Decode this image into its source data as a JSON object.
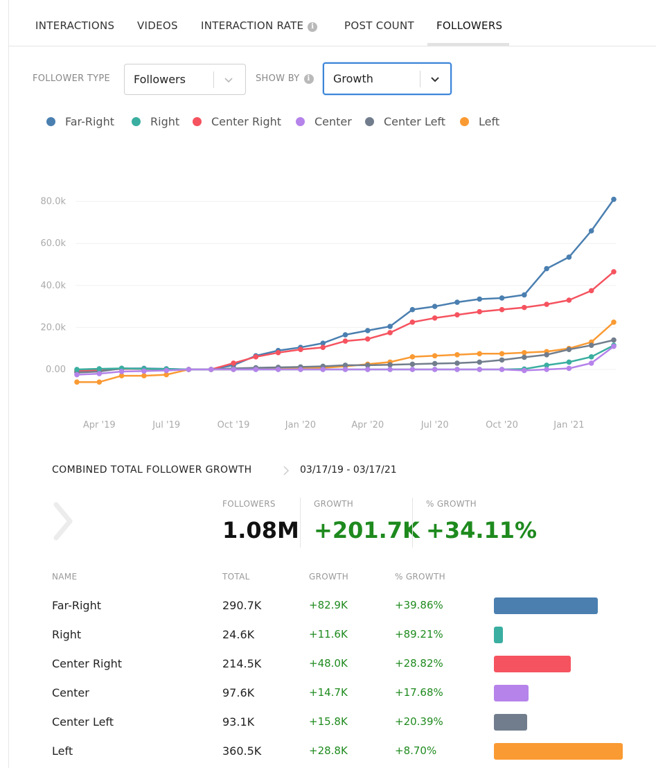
{
  "tabs": [
    {
      "label": "INTERACTIONS"
    },
    {
      "label": "VIDEOS"
    },
    {
      "label": "INTERACTION RATE"
    },
    {
      "label": "POST COUNT"
    },
    {
      "label": "FOLLOWERS",
      "active": true
    }
  ],
  "filters": {
    "follower_type_label": "FOLLOWER TYPE",
    "follower_type_value": "Followers",
    "show_by_label": "SHOW BY",
    "show_by_value": "Growth"
  },
  "chart_data": {
    "type": "line",
    "series": [
      {
        "name": "Far-Right",
        "color": "#4a7fb0",
        "values": [
          -1000,
          -600,
          500,
          500,
          300,
          0,
          0,
          2000,
          6500,
          9000,
          10500,
          12500,
          16500,
          18500,
          20500,
          28500,
          30000,
          32000,
          33500,
          34000,
          35500,
          48000,
          53500,
          66000,
          81000
        ]
      },
      {
        "name": "Right",
        "color": "#3aaea0",
        "values": [
          0,
          300,
          500,
          300,
          200,
          0,
          0,
          0,
          0,
          0,
          0,
          0,
          0,
          0,
          0,
          0,
          0,
          0,
          0,
          0,
          200,
          2000,
          3500,
          6000,
          11500
        ]
      },
      {
        "name": "Center Right",
        "color": "#f5535f",
        "values": [
          -500,
          -400,
          300,
          200,
          0,
          0,
          0,
          3000,
          6000,
          8000,
          9500,
          10500,
          13500,
          14500,
          17500,
          22500,
          24500,
          26000,
          27500,
          28500,
          29500,
          31000,
          33000,
          37500,
          46500
        ]
      },
      {
        "name": "Center",
        "color": "#b583ea",
        "values": [
          -2500,
          -2000,
          -1000,
          -800,
          -500,
          0,
          0,
          0,
          0,
          0,
          0,
          0,
          0,
          0,
          0,
          0,
          0,
          0,
          0,
          0,
          -500,
          0,
          500,
          3000,
          11000
        ]
      },
      {
        "name": "Center Left",
        "color": "#717d8c",
        "values": [
          -1500,
          -1000,
          500,
          300,
          0,
          0,
          0,
          500,
          800,
          1000,
          1200,
          1500,
          2000,
          2000,
          2200,
          2500,
          2800,
          3000,
          3500,
          4500,
          5800,
          7000,
          9500,
          11500,
          14000
        ]
      },
      {
        "name": "Left",
        "color": "#fa9a33",
        "values": [
          -6000,
          -6000,
          -3000,
          -3000,
          -2500,
          0,
          0,
          0,
          500,
          500,
          700,
          800,
          1500,
          2500,
          3500,
          6000,
          6500,
          7000,
          7500,
          7500,
          8000,
          8500,
          10000,
          13000,
          22500
        ]
      }
    ],
    "x_labels": [
      "Apr '19",
      "Jul '19",
      "Oct '19",
      "Jan '20",
      "Apr '20",
      "Jul '20",
      "Oct '20",
      "Jan '21"
    ],
    "y_ticks": [
      "0.00",
      "20.0k",
      "40.0k",
      "60.0k",
      "80.0k"
    ],
    "ylim": [
      -10000,
      90000
    ],
    "grid": true,
    "legend_position": "top-left"
  },
  "summary": {
    "title": "COMBINED TOTAL FOLLOWER GROWTH",
    "range": "03/17/19 - 03/17/21",
    "followers_label": "FOLLOWERS",
    "followers_value": "1.08M",
    "growth_label": "GROWTH",
    "growth_value": "+201.7K",
    "pct_label": "% GROWTH",
    "pct_value": "+34.11%"
  },
  "table": {
    "headers": [
      "NAME",
      "TOTAL",
      "GROWTH",
      "% GROWTH"
    ],
    "rows": [
      {
        "name": "Far-Right",
        "total": "290.7K",
        "growth": "+82.9K",
        "pct": "+39.86%",
        "color": "#4a7fb0",
        "share": 0.806
      },
      {
        "name": "Right",
        "total": "24.6K",
        "growth": "+11.6K",
        "pct": "+89.21%",
        "color": "#3aaea0",
        "share": 0.068
      },
      {
        "name": "Center Right",
        "total": "214.5K",
        "growth": "+48.0K",
        "pct": "+28.82%",
        "color": "#f5535f",
        "share": 0.595
      },
      {
        "name": "Center",
        "total": "97.6K",
        "growth": "+14.7K",
        "pct": "+17.68%",
        "color": "#b583ea",
        "share": 0.271
      },
      {
        "name": "Center Left",
        "total": "93.1K",
        "growth": "+15.8K",
        "pct": "+20.39%",
        "color": "#717d8c",
        "share": 0.258
      },
      {
        "name": "Left",
        "total": "360.5K",
        "growth": "+28.8K",
        "pct": "+8.70%",
        "color": "#fa9a33",
        "share": 1.0
      }
    ]
  }
}
